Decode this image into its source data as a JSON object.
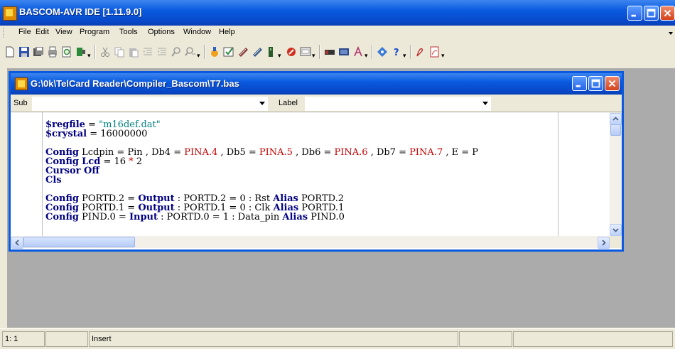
{
  "app": {
    "title": "BASCOM-AVR IDE [1.11.9.0]"
  },
  "menu": [
    "File",
    "Edit",
    "View",
    "Program",
    "Tools",
    "Options",
    "Window",
    "Help"
  ],
  "child": {
    "title": "G:\\0k\\TelCard Reader\\Compiler_Bascom\\T7.bas",
    "sub_label": "Sub",
    "label_label": "Label",
    "sub_value": "",
    "label_value": ""
  },
  "code": [
    [
      {
        "t": "$regfile",
        "c": "kw"
      },
      {
        "t": " = ",
        "c": "op"
      },
      {
        "t": "\"m16def.dat\"",
        "c": "str"
      }
    ],
    [
      {
        "t": "$crystal",
        "c": "kw"
      },
      {
        "t": " = ",
        "c": "op"
      },
      {
        "t": "16000000",
        "c": "num"
      }
    ],
    [],
    [
      {
        "t": "Config",
        "c": "kw"
      },
      {
        "t": " Lcdpin = Pin , Db4 = ",
        "c": "plain"
      },
      {
        "t": "PINA.4",
        "c": "red"
      },
      {
        "t": " , Db5 = ",
        "c": "plain"
      },
      {
        "t": "PINA.5",
        "c": "red"
      },
      {
        "t": " , Db6 = ",
        "c": "plain"
      },
      {
        "t": "PINA.6",
        "c": "red"
      },
      {
        "t": " , Db7 = ",
        "c": "plain"
      },
      {
        "t": "PINA.7",
        "c": "red"
      },
      {
        "t": " , E = P",
        "c": "plain"
      }
    ],
    [
      {
        "t": "Config",
        "c": "kw"
      },
      {
        "t": " ",
        "c": "plain"
      },
      {
        "t": "Lcd",
        "c": "kw"
      },
      {
        "t": " = ",
        "c": "op"
      },
      {
        "t": "16",
        "c": "num"
      },
      {
        "t": " * ",
        "c": "red"
      },
      {
        "t": "2",
        "c": "num"
      }
    ],
    [
      {
        "t": "Cursor Off",
        "c": "kw"
      }
    ],
    [
      {
        "t": "Cls",
        "c": "kw"
      }
    ],
    [],
    [
      {
        "t": "Config",
        "c": "kw"
      },
      {
        "t": " PORTD.2 = ",
        "c": "plain"
      },
      {
        "t": "Output",
        "c": "kw"
      },
      {
        "t": " : PORTD.2 = 0 : Rst ",
        "c": "plain"
      },
      {
        "t": "Alias",
        "c": "kw"
      },
      {
        "t": " PORTD.2",
        "c": "plain"
      }
    ],
    [
      {
        "t": "Config",
        "c": "kw"
      },
      {
        "t": " PORTD.1 = ",
        "c": "plain"
      },
      {
        "t": "Output",
        "c": "kw"
      },
      {
        "t": " : PORTD.1 = 0 : Clk ",
        "c": "plain"
      },
      {
        "t": "Alias",
        "c": "kw"
      },
      {
        "t": " PORTD.1",
        "c": "plain"
      }
    ],
    [
      {
        "t": "Config",
        "c": "kw"
      },
      {
        "t": " PIND.0 = ",
        "c": "plain"
      },
      {
        "t": "Input",
        "c": "kw"
      },
      {
        "t": " : PORTD.0 = 1 : Data_pin ",
        "c": "plain"
      },
      {
        "t": "Alias",
        "c": "kw"
      },
      {
        "t": " PIND.0",
        "c": "plain"
      }
    ]
  ],
  "status": {
    "position": "1: 1",
    "mode": "Insert"
  },
  "colors": {
    "keyword": "#000080",
    "string": "#008080",
    "red": "#c00000",
    "xp_blue": "#0a5adf"
  },
  "icons": [
    "new-file-icon",
    "save-icon",
    "save-all-icon",
    "print-icon",
    "print-preview-icon",
    "close-icon",
    "cut-icon",
    "copy-icon",
    "paste-icon",
    "indent-icon",
    "unindent-icon",
    "find-icon",
    "find-next-icon",
    "compile-icon",
    "syntax-check-icon",
    "chip-icon",
    "programmer-icon",
    "send-icon",
    "simulator-icon",
    "stop-icon",
    "terminal-icon",
    "lcd-designer-icon",
    "lib-manager-icon",
    "help-index-icon",
    "help-icon",
    "pdf-icon"
  ]
}
